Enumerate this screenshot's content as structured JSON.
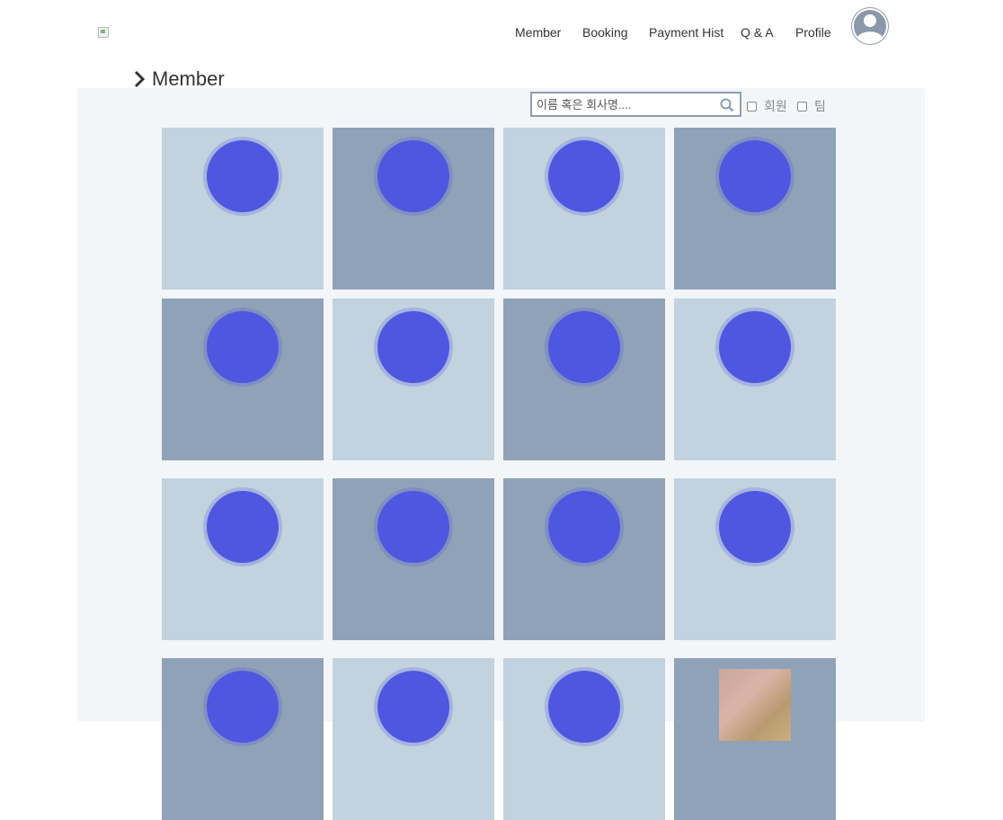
{
  "nav": {
    "items": [
      {
        "label": "Member"
      },
      {
        "label": "Booking"
      },
      {
        "label": "Payment Hist"
      },
      {
        "label": "Q & A"
      },
      {
        "label": "Profile"
      }
    ]
  },
  "section": {
    "title": "Member"
  },
  "search": {
    "placeholder": "이름 혹은 회사명...."
  },
  "filters": [
    {
      "label": "회원",
      "checked": false
    },
    {
      "label": "팀",
      "checked": false
    }
  ],
  "colors": {
    "panel_bg": "#f2f6f9",
    "card_light": "#c2d2df",
    "card_dark": "#8fa2b8",
    "avatar_circle": "#4f57e0"
  },
  "members": [
    {
      "name": "",
      "team": "",
      "tone": "light",
      "photo": false
    },
    {
      "name": "",
      "team": "",
      "tone": "dark",
      "photo": false
    },
    {
      "name": "",
      "team": "",
      "tone": "light",
      "photo": false
    },
    {
      "name": "",
      "team": "",
      "tone": "dark",
      "photo": false
    },
    {
      "name": "",
      "team": "",
      "tone": "dark",
      "photo": false
    },
    {
      "name": "",
      "team": "",
      "tone": "light",
      "photo": false
    },
    {
      "name": "",
      "team": "",
      "tone": "dark",
      "photo": false
    },
    {
      "name": "",
      "team": "",
      "tone": "light",
      "photo": false
    },
    {
      "name": "",
      "team": "",
      "tone": "light",
      "photo": false
    },
    {
      "name": "",
      "team": "",
      "tone": "dark",
      "photo": false
    },
    {
      "name": "",
      "team": "",
      "tone": "dark",
      "photo": false
    },
    {
      "name": "",
      "team": "",
      "tone": "light",
      "photo": false
    },
    {
      "name": "",
      "team": "",
      "tone": "dark",
      "photo": false
    },
    {
      "name": "",
      "team": "",
      "tone": "light",
      "photo": false
    },
    {
      "name": "",
      "team": "",
      "tone": "light",
      "photo": false
    },
    {
      "name": "",
      "team": "",
      "tone": "dark",
      "photo": true
    }
  ]
}
